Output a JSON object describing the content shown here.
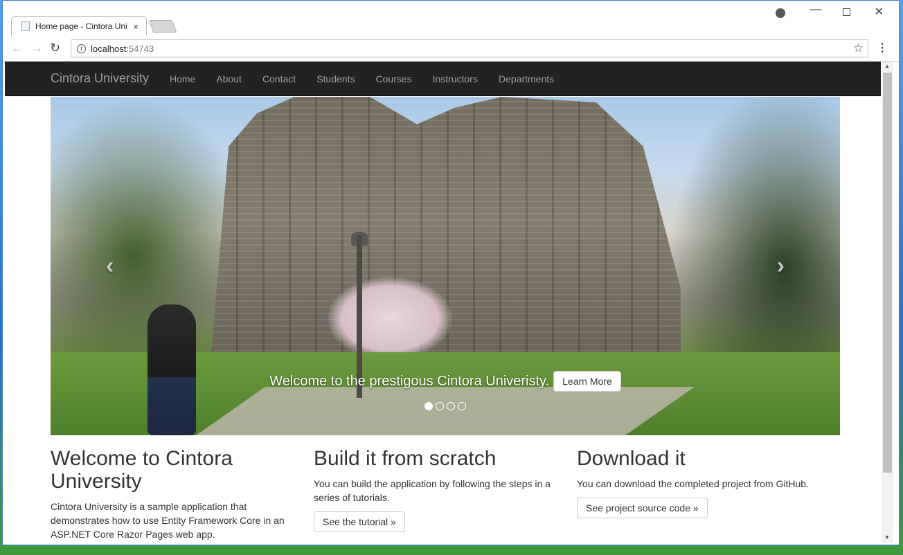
{
  "browser": {
    "tab_title": "Home page - Cintora Uni",
    "tab_close": "×",
    "url_host": "localhost",
    "url_port": ":54743",
    "icons": {
      "back": "arrow-left",
      "forward": "arrow-right",
      "reload": "reload",
      "info": "info",
      "star": "star",
      "menu": "vertical-dots",
      "account": "account",
      "minimize": "minimize",
      "maximize": "maximize",
      "close": "close"
    }
  },
  "site": {
    "brand": "Cintora University",
    "nav": [
      "Home",
      "About",
      "Contact",
      "Students",
      "Courses",
      "Instructors",
      "Departments"
    ]
  },
  "carousel": {
    "caption": "Welcome to the prestigous Cintora Univeristy.",
    "button": "Learn More",
    "slide_count": 4,
    "active_index": 0
  },
  "columns": [
    {
      "heading": "Welcome to Cintora University",
      "text": "Cintora University is a sample application that demonstrates how to use Entity Framework Core in an ASP.NET Core Razor Pages web app.",
      "button": ""
    },
    {
      "heading": "Build it from scratch",
      "text": "You can build the application by following the steps in a series of tutorials.",
      "button": "See the tutorial »"
    },
    {
      "heading": "Download it",
      "text": "You can download the completed project from GitHub.",
      "button": "See project source code »"
    }
  ],
  "colors": {
    "navbar_bg": "#222222",
    "navbar_text": "#9d9d9d"
  }
}
